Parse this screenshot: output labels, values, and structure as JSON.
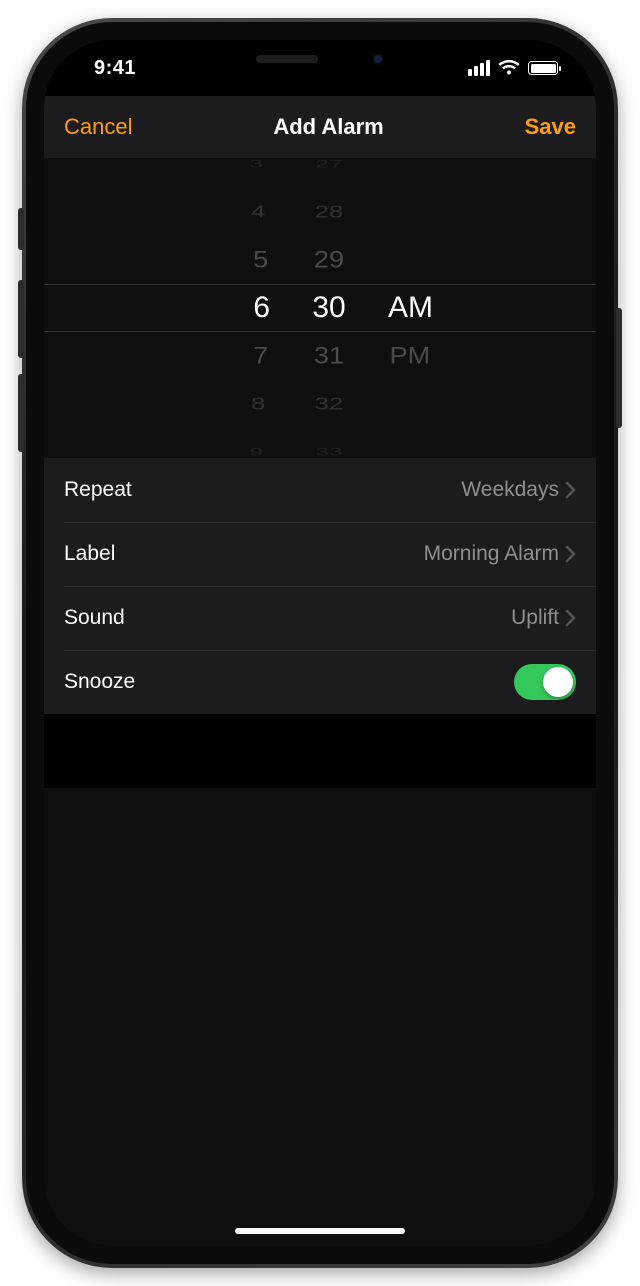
{
  "status": {
    "time": "9:41"
  },
  "nav": {
    "cancel": "Cancel",
    "title": "Add Alarm",
    "save": "Save"
  },
  "picker": {
    "hours": [
      "3",
      "4",
      "5",
      "6",
      "7",
      "8",
      "9"
    ],
    "minutes": [
      "27",
      "28",
      "29",
      "30",
      "31",
      "32",
      "33"
    ],
    "periods": [
      "AM",
      "PM"
    ],
    "selected": {
      "hour": "6",
      "minute": "30",
      "period": "AM"
    }
  },
  "settings": {
    "repeat": {
      "label": "Repeat",
      "value": "Weekdays"
    },
    "label": {
      "label": "Label",
      "value": "Morning Alarm"
    },
    "sound": {
      "label": "Sound",
      "value": "Uplift"
    },
    "snooze": {
      "label": "Snooze",
      "on": true
    }
  },
  "colors": {
    "accent": "#ff9d0a",
    "switch_on": "#34c759"
  }
}
